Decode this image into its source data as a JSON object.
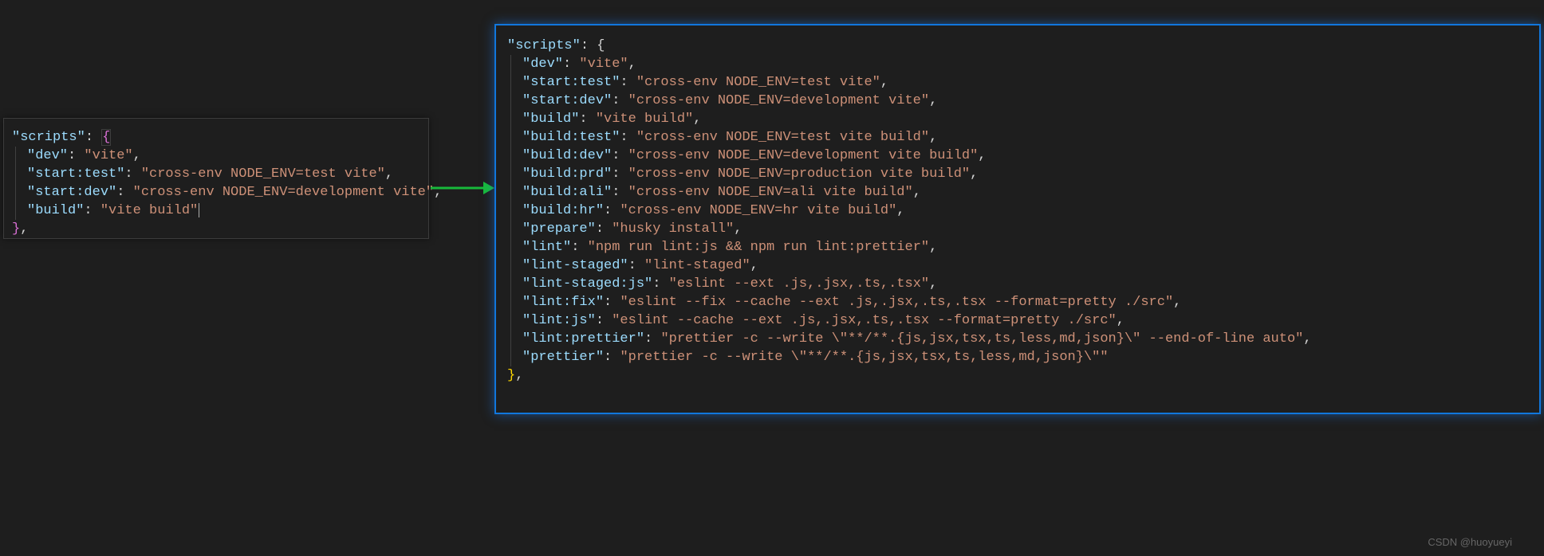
{
  "left": {
    "header_key": "\"scripts\"",
    "scripts": [
      {
        "key": "\"dev\"",
        "value": "\"vite\"",
        "trailing": ","
      },
      {
        "key": "\"start:test\"",
        "value": "\"cross-env NODE_ENV=test vite\"",
        "trailing": ","
      },
      {
        "key": "\"start:dev\"",
        "value": "\"cross-env NODE_ENV=development vite\"",
        "trailing": ","
      },
      {
        "key": "\"build\"",
        "value": "\"vite build\"",
        "trailing": ""
      }
    ]
  },
  "right": {
    "header_key": "\"scripts\"",
    "scripts": [
      {
        "key": "\"dev\"",
        "value": "\"vite\"",
        "trailing": ","
      },
      {
        "key": "\"start:test\"",
        "value": "\"cross-env NODE_ENV=test vite\"",
        "trailing": ","
      },
      {
        "key": "\"start:dev\"",
        "value": "\"cross-env NODE_ENV=development vite\"",
        "trailing": ","
      },
      {
        "key": "\"build\"",
        "value": "\"vite build\"",
        "trailing": ","
      },
      {
        "key": "\"build:test\"",
        "value": "\"cross-env NODE_ENV=test vite build\"",
        "trailing": ","
      },
      {
        "key": "\"build:dev\"",
        "value": "\"cross-env NODE_ENV=development vite build\"",
        "trailing": ","
      },
      {
        "key": "\"build:prd\"",
        "value": "\"cross-env NODE_ENV=production vite build\"",
        "trailing": ","
      },
      {
        "key": "\"build:ali\"",
        "value": "\"cross-env NODE_ENV=ali vite build\"",
        "trailing": ","
      },
      {
        "key": "\"build:hr\"",
        "value": "\"cross-env NODE_ENV=hr vite build\"",
        "trailing": ","
      },
      {
        "key": "\"prepare\"",
        "value": "\"husky install\"",
        "trailing": ","
      },
      {
        "key": "\"lint\"",
        "value": "\"npm run lint:js && npm run lint:prettier\"",
        "trailing": ","
      },
      {
        "key": "\"lint-staged\"",
        "value": "\"lint-staged\"",
        "trailing": ","
      },
      {
        "key": "\"lint-staged:js\"",
        "value": "\"eslint --ext .js,.jsx,.ts,.tsx\"",
        "trailing": ","
      },
      {
        "key": "\"lint:fix\"",
        "value": "\"eslint --fix --cache --ext .js,.jsx,.ts,.tsx --format=pretty ./src\"",
        "trailing": ","
      },
      {
        "key": "\"lint:js\"",
        "value": "\"eslint --cache --ext .js,.jsx,.ts,.tsx --format=pretty ./src\"",
        "trailing": ","
      },
      {
        "key": "\"lint:prettier\"",
        "value": "\"prettier -c --write \\\"**/**.{js,jsx,tsx,ts,less,md,json}\\\" --end-of-line auto\"",
        "trailing": ","
      },
      {
        "key": "\"prettier\"",
        "value": "\"prettier -c --write \\\"**/**.{js,jsx,tsx,ts,less,md,json}\\\"\"",
        "trailing": ""
      }
    ]
  },
  "watermark": "CSDN @huoyueyi",
  "colors": {
    "bg": "#1e1e1e",
    "key": "#9cdcfe",
    "string": "#ce9178",
    "punct": "#d4d4d4",
    "brace_highlight": "#da70d6",
    "selection_border": "#1177dd",
    "arrow": "#18b93b"
  }
}
